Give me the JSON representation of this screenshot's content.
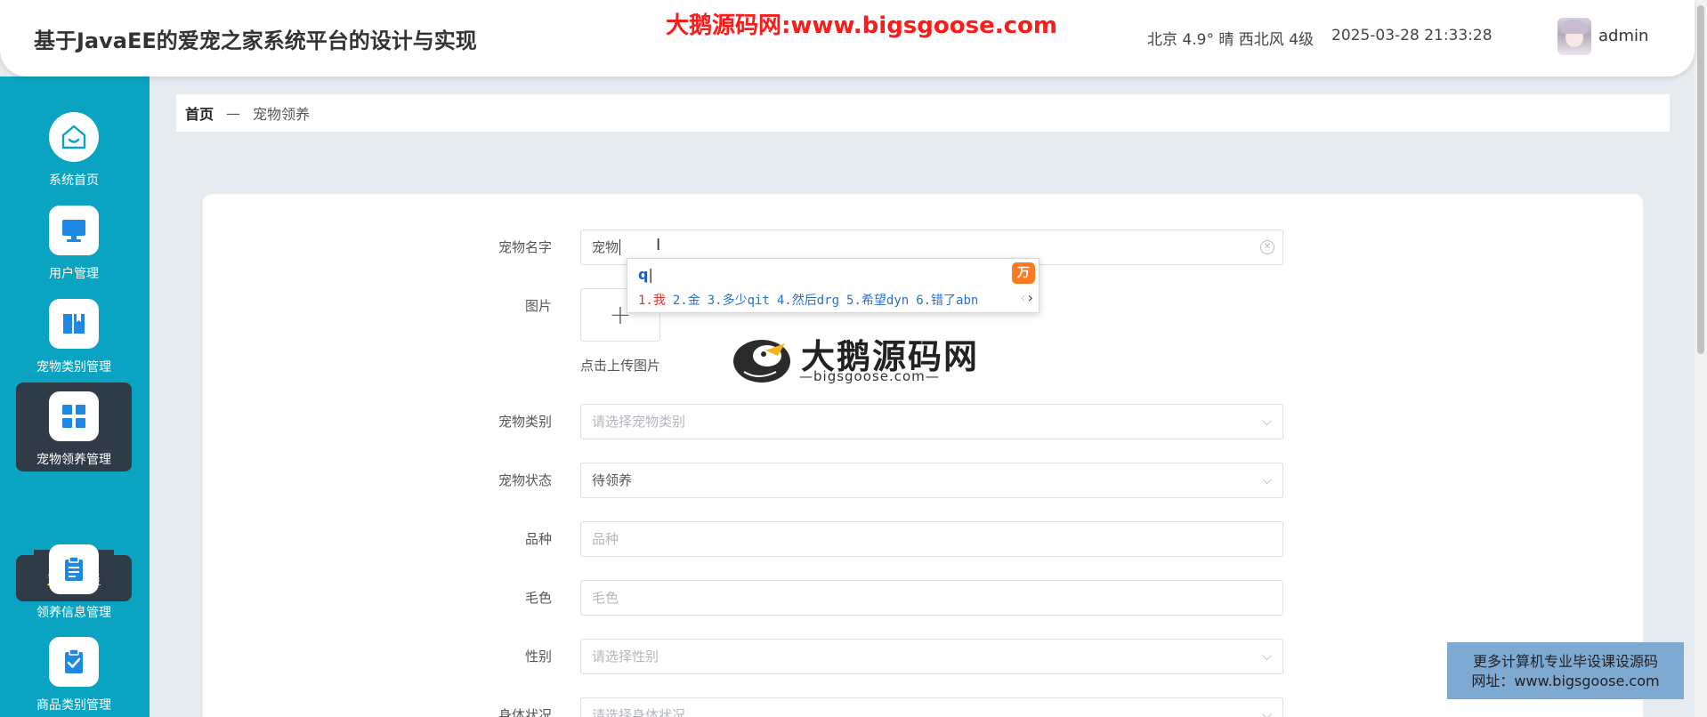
{
  "header": {
    "title": "基于JavaEE的爱宠之家系统平台的设计与实现",
    "watermark": "大鹅源码网:www.bigsgoose.com",
    "weather": "北京 4.9° 晴 西北风 4级",
    "datetime": "2025-03-28 21:33:28",
    "username": "admin"
  },
  "sidebar": {
    "items": [
      {
        "label": "系统首页",
        "icon": "home-icon"
      },
      {
        "label": "用户管理",
        "icon": "monitor-icon"
      },
      {
        "label": "宠物类别管理",
        "icon": "book-icon"
      },
      {
        "label": "宠物领养管理",
        "icon": "grid-icon"
      },
      {
        "label": "领养信息管理",
        "icon": "clipboard-icon"
      },
      {
        "label": "商品类别管理",
        "icon": "clipboard-check-icon"
      }
    ],
    "active_sub": "宠物领养"
  },
  "breadcrumb": {
    "home": "首页",
    "separator": "—",
    "current": "宠物领养"
  },
  "form": {
    "pet_name": {
      "label": "宠物名字",
      "value": "宠物"
    },
    "image": {
      "label": "图片",
      "upload_symbol": "+",
      "hint": "点击上传图片"
    },
    "category": {
      "label": "宠物类别",
      "placeholder": "请选择宠物类别"
    },
    "status": {
      "label": "宠物状态",
      "value": "待领养"
    },
    "breed": {
      "label": "品种",
      "placeholder": "品种"
    },
    "fur_color": {
      "label": "毛色",
      "placeholder": "毛色"
    },
    "gender": {
      "label": "性别",
      "placeholder": "请选择性别"
    },
    "health": {
      "label": "身体状况",
      "placeholder": "请选择身体状况"
    }
  },
  "ime": {
    "input": "q",
    "logo": "万",
    "candidates": [
      "1.我",
      "2.金",
      "3.多少qit",
      "4.然后drg",
      "5.希望dyn",
      "6.错了abn"
    ]
  },
  "logo_watermark": {
    "cn": "大鹅源码网",
    "en": "—bigsgoose.com—"
  },
  "promo": {
    "line1": "更多计算机专业毕设课设源码",
    "line2": "网址：www.bigsgoose.com"
  },
  "colors": {
    "sidebar_bg": "#0aa4c2",
    "sidebar_active": "#2f3b47",
    "sub_active_text": "#ffd21e",
    "watermark_red": "#ff1a1a",
    "icon_blue": "#1e88e5"
  }
}
